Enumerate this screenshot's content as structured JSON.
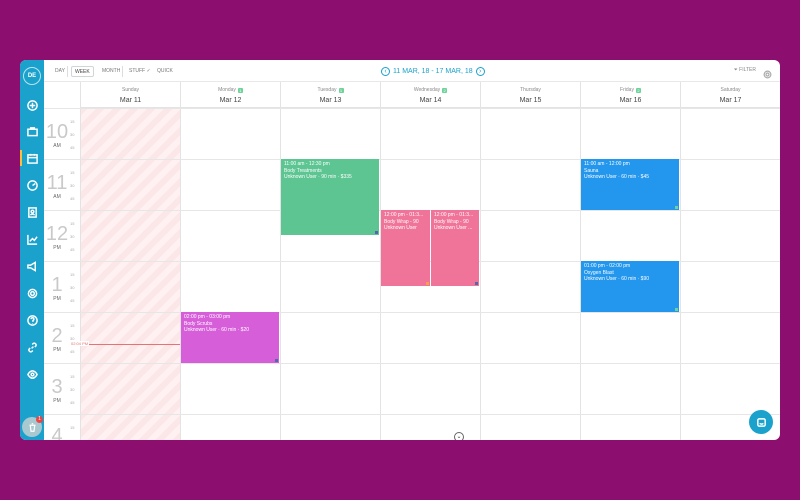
{
  "user": {
    "initials": "DE"
  },
  "sidebar": {
    "icons": [
      "plus-icon",
      "briefcase-icon",
      "calendar-icon",
      "speedometer-icon",
      "contacts-icon",
      "chart-icon",
      "megaphone-icon",
      "settings-icon",
      "help-icon",
      "link-icon",
      "eye-icon"
    ],
    "notification_count": "1"
  },
  "toolbar": {
    "views": [
      "DAY",
      "WEEK",
      "MONTH",
      "STUFF ✓",
      "QUICK"
    ],
    "selected_view": "WEEK",
    "date_range": "11 MAR, 18 - 17 MAR, 18",
    "filter_label": "FILTER"
  },
  "days": [
    {
      "name": "Sunday",
      "date": "Mar 11",
      "badge": ""
    },
    {
      "name": "Monday",
      "date": "Mar 12",
      "badge": "1"
    },
    {
      "name": "Tuesday",
      "date": "Mar 13",
      "badge": "1"
    },
    {
      "name": "Wednesday",
      "date": "Mar 14",
      "badge": "2"
    },
    {
      "name": "Thursday",
      "date": "Mar 15",
      "badge": ""
    },
    {
      "name": "Friday",
      "date": "Mar 16",
      "badge": "2"
    },
    {
      "name": "Saturday",
      "date": "Mar 17",
      "badge": ""
    }
  ],
  "hours": [
    {
      "num": "10",
      "ampm": "AM"
    },
    {
      "num": "11",
      "ampm": "AM"
    },
    {
      "num": "12",
      "ampm": "PM"
    },
    {
      "num": "1",
      "ampm": "PM"
    },
    {
      "num": "2",
      "ampm": "PM"
    },
    {
      "num": "3",
      "ampm": "PM"
    },
    {
      "num": "4",
      "ampm": ""
    }
  ],
  "minute_marks": [
    "15",
    "30",
    "45"
  ],
  "now_label": "02:04 PM",
  "events": [
    {
      "time": "11:00 am - 12:30 pm",
      "service": "Body Treatments",
      "detail": "Unknown User · 90 min · $335",
      "color": "#5cc592"
    },
    {
      "time": "12:00 pm - 01:3...",
      "service": "Body Wrap - 90",
      "detail": "Unknown User",
      "color": "#f07399"
    },
    {
      "time": "12:00 pm - 01:3...",
      "service": "Body Wrap - 90",
      "detail": "Unknown User ...",
      "color": "#f07399"
    },
    {
      "time": "11:00 am - 12:00 pm",
      "service": "Sauna",
      "detail": "Unknown User · 60 min · $45",
      "color": "#2396ee"
    },
    {
      "time": "01:00 pm - 02:00 pm",
      "service": "Oxygen Blast",
      "detail": "Unknown User · 60 min · $90",
      "color": "#2396ee"
    },
    {
      "time": "02:00 pm - 03:00 pm",
      "service": "Body Scrubs",
      "detail": "Unknown User · 60 min · $20",
      "color": "#d65fd9"
    }
  ]
}
